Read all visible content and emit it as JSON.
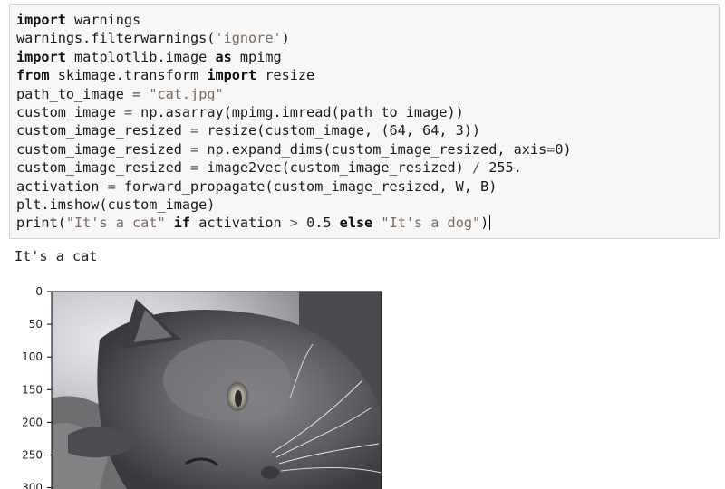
{
  "code_cell": {
    "lines": [
      [
        [
          "kw",
          "import"
        ],
        [
          "t",
          " warnings"
        ]
      ],
      [
        [
          "t",
          "warnings.filterwarnings("
        ],
        [
          "str",
          "'ignore'"
        ],
        [
          "t",
          ")"
        ]
      ],
      [
        [
          "kw",
          "import"
        ],
        [
          "t",
          " matplotlib.image "
        ],
        [
          "kw",
          "as"
        ],
        [
          "t",
          " mpimg"
        ]
      ],
      [
        [
          "kw",
          "from"
        ],
        [
          "t",
          " skimage.transform "
        ],
        [
          "kw",
          "import"
        ],
        [
          "t",
          " resize"
        ]
      ],
      [
        [
          "t",
          "path_to_image "
        ],
        [
          "op",
          "="
        ],
        [
          "t",
          " "
        ],
        [
          "str",
          "\"cat.jpg\""
        ]
      ],
      [
        [
          "t",
          "custom_image "
        ],
        [
          "op",
          "="
        ],
        [
          "t",
          " np.asarray(mpimg.imread(path_to_image))"
        ]
      ],
      [
        [
          "t",
          "custom_image_resized "
        ],
        [
          "op",
          "="
        ],
        [
          "t",
          " resize(custom_image, (64, 64, 3))"
        ]
      ],
      [
        [
          "t",
          "custom_image_resized "
        ],
        [
          "op",
          "="
        ],
        [
          "t",
          " np.expand_dims(custom_image_resized, axis"
        ],
        [
          "op",
          "="
        ],
        [
          "t",
          "0)"
        ]
      ],
      [
        [
          "t",
          "custom_image_resized "
        ],
        [
          "op",
          "="
        ],
        [
          "t",
          " image2vec(custom_image_resized) "
        ],
        [
          "op",
          "/"
        ],
        [
          "t",
          " 255."
        ]
      ],
      [
        [
          "t",
          "activation "
        ],
        [
          "op",
          "="
        ],
        [
          "t",
          " forward_propagate(custom_image_resized, W, B)"
        ]
      ],
      [
        [
          "t",
          "plt.imshow(custom_image)"
        ]
      ],
      [
        [
          "t",
          "print("
        ],
        [
          "str",
          "\"It's a cat\""
        ],
        [
          "t",
          " "
        ],
        [
          "kw",
          "if"
        ],
        [
          "t",
          " activation "
        ],
        [
          "op",
          ">"
        ],
        [
          "t",
          " 0.5 "
        ],
        [
          "kw",
          "else"
        ],
        [
          "t",
          " "
        ],
        [
          "str",
          "\"It's a dog\""
        ],
        [
          "t",
          ")"
        ]
      ]
    ]
  },
  "output": {
    "text": "It's a cat"
  },
  "image_plot": {
    "y_ticks": [
      "0",
      "50",
      "100",
      "150",
      "200",
      "250",
      "300"
    ],
    "tick_values": [
      0,
      50,
      100,
      150,
      200,
      250,
      300
    ],
    "y_visible_max": 300
  },
  "colors": {
    "cell_background": "#f7f7f7",
    "cell_border": "#cfcfcf",
    "string": "#7a6a63"
  },
  "icons": {
    "cat_photo": "cat-photo-image"
  }
}
